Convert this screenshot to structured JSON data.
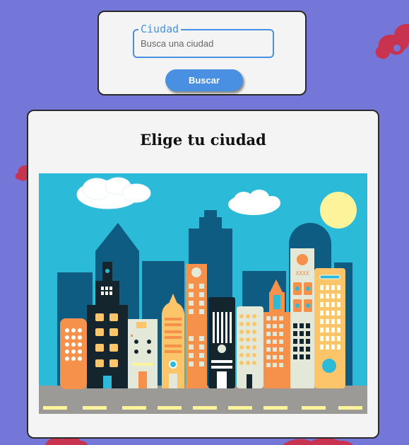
{
  "search": {
    "legend": "Ciudad",
    "placeholder": "Busca una ciudad",
    "button_label": "Buscar"
  },
  "main": {
    "title": "Elige tu ciudad",
    "illustration_sign": "XXXX"
  },
  "colors": {
    "background": "#7476d8",
    "card": "#f4f4f4",
    "accent": "#4a90e2",
    "deco_cloud": "#c8344f"
  }
}
